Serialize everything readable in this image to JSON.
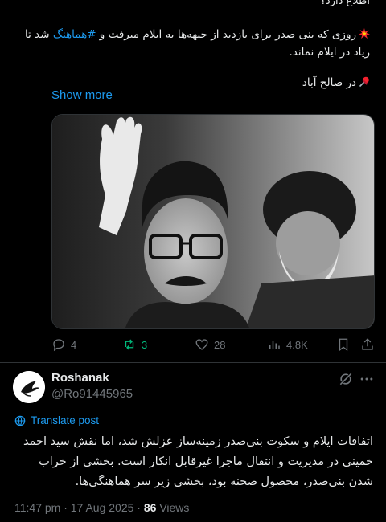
{
  "previous_tweet": {
    "top_cut_text": "اطلاع دارد؟",
    "paragraph1_before": "روزی که بنی صدر برای بازدید از جبهه‌ها به ایلام میرفت و ",
    "paragraph1_hashtag": "#هماهنگ",
    "paragraph1_after": " شد تا زیاد در ایلام نماند.",
    "paragraph2": "در صالح آباد",
    "show_more": "Show more",
    "photo_icon": "historical-photo",
    "counts": {
      "replies": "4",
      "reposts": "3",
      "likes": "28",
      "views": "4.8K"
    }
  },
  "reply_tweet": {
    "name": "Roshanak",
    "handle": "@Ro91445965",
    "translate_label": "Translate post",
    "text": "اتفاقات ایلام و سکوت بنی‌صدر زمینه‌ساز عزلش شد، اما نقش سید احمد خمینی در مدیریت و انتقال ماجرا غیرقابل انکار است. بخشی از خراب شدن بنی‌صدر، محصول صحنه بود، بخشی زیر سر هماهنگی‌ها.",
    "time": "11:47 pm · 17 Aug 2025 · ",
    "views_count": "86",
    "views_label": " Views"
  },
  "colors": {
    "accent": "#1d9bf0",
    "repost_green": "#00ba7c",
    "muted": "#71767b",
    "text": "#e7e9ea",
    "background": "#000000"
  }
}
